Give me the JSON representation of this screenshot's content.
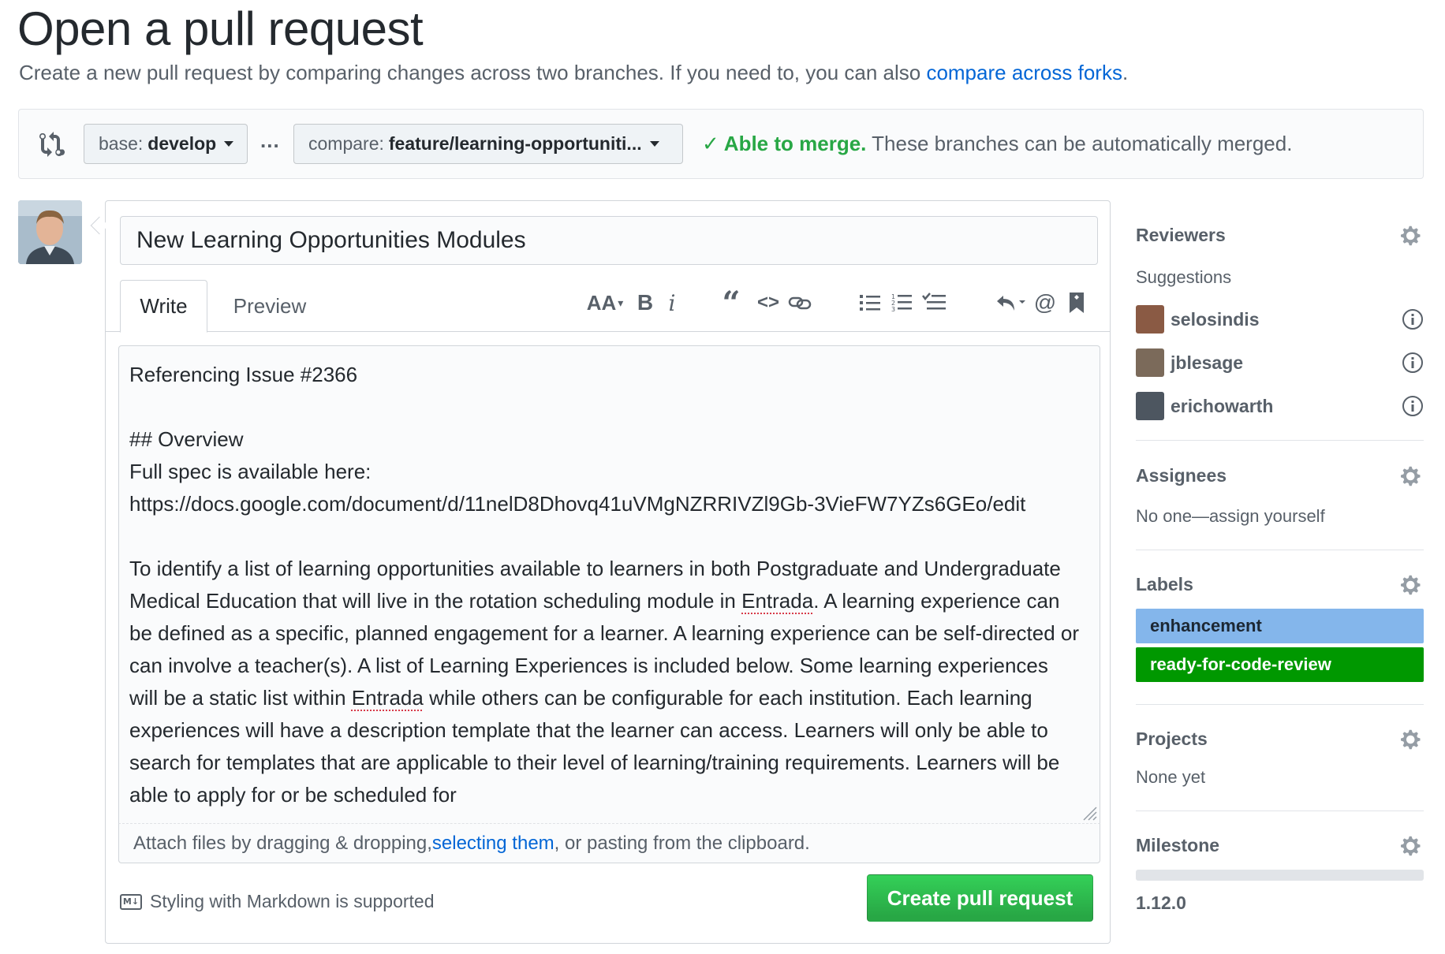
{
  "header": {
    "title": "Open a pull request",
    "subtitle": "Create a new pull request by comparing changes across two branches. If you need to, you can also ",
    "subtitle_link": "compare across forks",
    "subtitle_end": "."
  },
  "compare": {
    "base_label": "base:",
    "base_branch": "develop",
    "separator": "...",
    "compare_label": "compare:",
    "compare_branch": "feature/learning-opportuniti...",
    "merge_status": "Able to merge.",
    "merge_detail": "These branches can be automatically merged."
  },
  "form": {
    "title_value": "New Learning Opportunities Modules",
    "tabs": [
      "Write",
      "Preview"
    ],
    "toolbar_icons": [
      "text-size-icon",
      "bold-icon",
      "italic-icon",
      "quote-icon",
      "code-icon",
      "link-icon",
      "bullet-list-icon",
      "numbered-list-icon",
      "task-list-icon",
      "reply-icon",
      "mention-icon",
      "bookmark-icon"
    ],
    "body": {
      "line1": "Referencing Issue #2366",
      "line2": "## Overview",
      "line3": "Full spec is available here:",
      "line4": "https://docs.google.com/document/d/11nelD8Dhovq41uVMgNZRRIVZl9Gb-3VieFW7YZs6GEo/edit",
      "para_a": "To identify a list of learning opportunities available to learners in both Postgraduate and Undergraduate Medical Education that will live in the rotation scheduling module in ",
      "entrada1": "Entrada",
      "para_b": ". A learning experience can be defined as a specific, planned engagement for a learner. A learning experience can be self-directed or can involve a teacher(s). A list of Learning Experiences is included below. Some learning experiences will be a static list within ",
      "entrada2": "Entrada",
      "para_c": " while others can be configurable for each institution. Each learning experiences will have a description template that the learner can access. Learners will only be able to search for templates that are applicable to their level of learning/training requirements. Learners will be able to apply for or be scheduled for"
    },
    "attach_prefix": "Attach files by dragging & dropping, ",
    "attach_link": "selecting them",
    "attach_suffix": ", or pasting from the clipboard.",
    "markdown_note": "Styling with Markdown is supported",
    "markdown_icon_text": "M↓",
    "submit_label": "Create pull request"
  },
  "sidebar": {
    "reviewers": {
      "title": "Reviewers",
      "suggestions_label": "Suggestions",
      "people": [
        {
          "name": "selosindis",
          "avatar_color": "#8a5a44"
        },
        {
          "name": "jblesage",
          "avatar_color": "#7b6a5a"
        },
        {
          "name": "erichowarth",
          "avatar_color": "#4d5660"
        }
      ]
    },
    "assignees": {
      "title": "Assignees",
      "text": "No one—assign yourself"
    },
    "labels": {
      "title": "Labels",
      "items": [
        {
          "name": "enhancement",
          "color": "#84b6eb",
          "text_color": "#1c2733"
        },
        {
          "name": "ready-for-code-review",
          "color": "#009800",
          "text_color": "#ffffff"
        }
      ]
    },
    "projects": {
      "title": "Projects",
      "text": "None yet"
    },
    "milestone": {
      "title": "Milestone",
      "name": "1.12.0",
      "progress": 0
    }
  },
  "colors": {
    "link": "#0366d6",
    "success": "#28a745",
    "muted": "#586069"
  }
}
